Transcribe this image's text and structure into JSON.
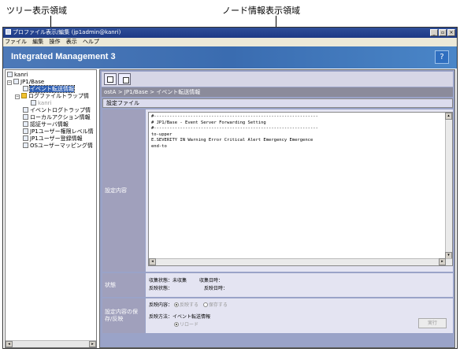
{
  "callouts": {
    "tree_area": "ツリー表示領域",
    "node_area": "ノード情報表示領域"
  },
  "window": {
    "title": "プロファイル表示/編集 (jp1admin@kanri)",
    "buttons": [
      "_",
      "▫",
      "×"
    ]
  },
  "menu": [
    "ファイル",
    "編集",
    "操作",
    "表示",
    "ヘルプ"
  ],
  "banner": {
    "brand": "Integrated Management 3",
    "help": "?"
  },
  "tree": {
    "nodes": [
      {
        "label": "kanri"
      },
      {
        "label": "JP1/Base"
      },
      {
        "label": "イベント転送情報"
      },
      {
        "label": "ログファイルトラップ情"
      },
      {
        "label": "kanri"
      },
      {
        "label": "イベントログトラップ情"
      },
      {
        "label": "ローカルアクション情報"
      },
      {
        "label": "認証サーバ情報"
      },
      {
        "label": "JP1ユーザー権限レベル情"
      },
      {
        "label": "JP1ユーザー登録情報"
      },
      {
        "label": "OSユーザーマッピング情"
      }
    ]
  },
  "node_info": {
    "breadcrumb": "ostA > JP1/Base > イベント転送情報",
    "section_tab": "設定ファイル",
    "settings_label": "設定内容",
    "file_lines": [
      "#---------------------------------------------------------------",
      "# JP1/Base - Event Server Forwarding Setting",
      "#---------------------------------------------------------------",
      "to-upper",
      "E.SEVERITY IN Warning Error Critical Alert Emergency Emergence",
      "end-to"
    ],
    "status": {
      "label": "状態",
      "collect_state_label": "収集状態：",
      "collect_state": "未収集",
      "collect_time_label": "収集日時：",
      "apply_state_label": "反映状態：",
      "apply_time_label": "反映日時："
    },
    "apply": {
      "label": "設定内容の保存/反映",
      "content_label": "反映内容：",
      "option1": "反映する",
      "option2": "保存する",
      "method_label": "反映方法：",
      "method_value": "イベント転送情報",
      "reload": "リロード",
      "exec_button": "実行"
    }
  }
}
